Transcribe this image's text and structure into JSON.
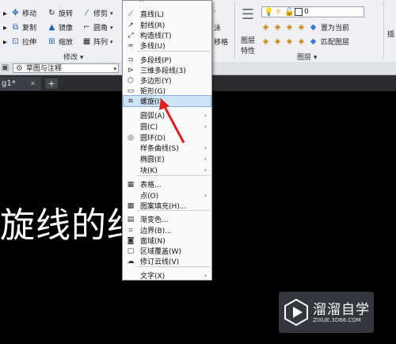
{
  "ribbon": {
    "modify": {
      "move": "移动",
      "rotate": "旋转",
      "trim": "修剪",
      "copy": "复制",
      "mirror": "镜像",
      "fillet": "圆角",
      "stretch": "拉伸",
      "scale": "缩放",
      "array": "阵列",
      "group_label": "修改 ▾"
    },
    "right_col": {
      "item1": "·",
      "item2": "泳",
      "item3": "移格"
    },
    "layers": {
      "properties_label_1": "图层",
      "properties_label_2": "特性",
      "layer_value": "0",
      "make_current": "置为当前",
      "match_layer": "匹配图层",
      "group_label": "图层 ▾"
    },
    "insert_partial": "插"
  },
  "workspace": {
    "value": "草图与注释"
  },
  "document_tab": {
    "label": "g1*"
  },
  "canvas": {
    "large_text": "旋线的约"
  },
  "draw_menu": {
    "items": [
      {
        "label": "直线(L)",
        "icon": "line-icon",
        "glyph": "⟋",
        "arrow": false
      },
      {
        "label": "射线(R)",
        "icon": "ray-icon",
        "glyph": "↗",
        "arrow": false
      },
      {
        "label": "构造线(T)",
        "icon": "xline-icon",
        "glyph": "⤢",
        "arrow": false
      },
      {
        "label": "多线(U)",
        "icon": "mline-icon",
        "glyph": "≈",
        "arrow": false
      },
      {
        "label": "多段线(P)",
        "icon": "pline-icon",
        "glyph": "⊃",
        "arrow": false
      },
      {
        "label": "三维多段线(3)",
        "icon": "3dpoly-icon",
        "glyph": "⊳",
        "arrow": false
      },
      {
        "label": "多边形(Y)",
        "icon": "polygon-icon",
        "glyph": "⬡",
        "arrow": false
      },
      {
        "label": "矩形(G)",
        "icon": "rectangle-icon",
        "glyph": "▭",
        "arrow": false
      },
      {
        "label": "螺旋(I)",
        "icon": "helix-icon",
        "glyph": "≋",
        "arrow": false
      },
      {
        "label": "圆弧(A)",
        "icon": "",
        "glyph": "",
        "arrow": true
      },
      {
        "label": "圆(C)",
        "icon": "",
        "glyph": "",
        "arrow": true
      },
      {
        "label": "圆环(D)",
        "icon": "donut-icon",
        "glyph": "◎",
        "arrow": false
      },
      {
        "label": "样条曲线(S)",
        "icon": "",
        "glyph": "",
        "arrow": true
      },
      {
        "label": "椭圆(E)",
        "icon": "",
        "glyph": "",
        "arrow": true
      },
      {
        "label": "块(K)",
        "icon": "",
        "glyph": "",
        "arrow": true
      },
      {
        "label": "表格...",
        "icon": "table-icon",
        "glyph": "▦",
        "arrow": false
      },
      {
        "label": "点(O)",
        "icon": "",
        "glyph": "",
        "arrow": true
      },
      {
        "label": "图案填充(H)...",
        "icon": "hatch-icon",
        "glyph": "▩",
        "arrow": false
      },
      {
        "label": "渐变色...",
        "icon": "gradient-icon",
        "glyph": "▤",
        "arrow": false
      },
      {
        "label": "边界(B)...",
        "icon": "boundary-icon",
        "glyph": "⌗",
        "arrow": false
      },
      {
        "label": "面域(N)",
        "icon": "region-icon",
        "glyph": "◙",
        "arrow": false
      },
      {
        "label": "区域覆盖(W)",
        "icon": "wipeout-icon",
        "glyph": "▢",
        "arrow": false
      },
      {
        "label": "修订云线(V)",
        "icon": "revcloud-icon",
        "glyph": "☁",
        "arrow": false
      },
      {
        "label": "文字(X)",
        "icon": "",
        "glyph": "",
        "arrow": true
      }
    ]
  },
  "watermark": {
    "name": "溜溜自学",
    "url": "ZIXUE.3D66.COM"
  },
  "colors": {
    "highlight": "#cfe3f7",
    "arrow": "#e02020",
    "canvas": "#000000"
  }
}
